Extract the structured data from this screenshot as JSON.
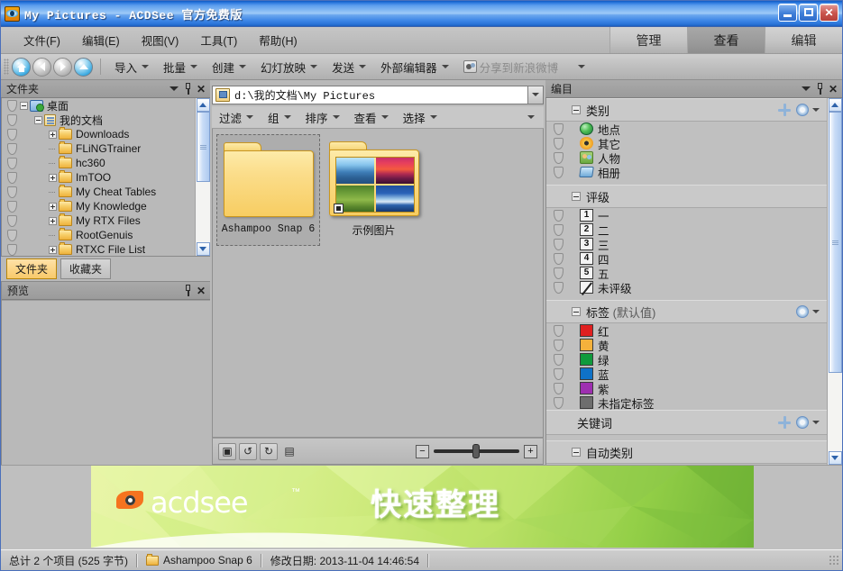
{
  "window": {
    "title": "My Pictures - ACDSee 官方免费版",
    "app_icon": "acdsee-eye-icon",
    "minimize_label": "_",
    "maximize_label": "□",
    "close_label": "✕"
  },
  "menubar": {
    "items": [
      {
        "label": "文件(F)",
        "accel": "F"
      },
      {
        "label": "编辑(E)",
        "accel": "E"
      },
      {
        "label": "视图(V)",
        "accel": "V"
      },
      {
        "label": "工具(T)",
        "accel": "T"
      },
      {
        "label": "帮助(H)",
        "accel": "H"
      }
    ],
    "mode_tabs": [
      {
        "label": "管理",
        "active": false
      },
      {
        "label": "查看",
        "active": true
      },
      {
        "label": "编辑",
        "active": false
      }
    ]
  },
  "toolbar": {
    "nav": [
      {
        "name": "home-button",
        "glyph": "home"
      },
      {
        "name": "back-button",
        "glyph": "left"
      },
      {
        "name": "forward-button",
        "glyph": "right"
      },
      {
        "name": "up-button",
        "glyph": "up"
      }
    ],
    "items": [
      {
        "label": "导入"
      },
      {
        "label": "批量"
      },
      {
        "label": "创建"
      },
      {
        "label": "幻灯放映"
      },
      {
        "label": "发送"
      },
      {
        "label": "外部编辑器"
      }
    ],
    "share": {
      "label": "分享到新浪微博",
      "icon": "weibo-icon"
    }
  },
  "folders_panel": {
    "title": "文件夹",
    "tree": [
      {
        "label": "桌面",
        "depth": 0,
        "expander": "minus",
        "icon": "desktop-icon"
      },
      {
        "label": "我的文档",
        "depth": 1,
        "expander": "minus",
        "icon": "my-documents-icon"
      },
      {
        "label": "Downloads",
        "depth": 2,
        "expander": "plus",
        "icon": "folder-icon"
      },
      {
        "label": "FLiNGTrainer",
        "depth": 2,
        "expander": "none",
        "icon": "folder-icon"
      },
      {
        "label": "hc360",
        "depth": 2,
        "expander": "none",
        "icon": "folder-icon"
      },
      {
        "label": "ImTOO",
        "depth": 2,
        "expander": "plus",
        "icon": "folder-icon"
      },
      {
        "label": "My Cheat Tables",
        "depth": 2,
        "expander": "none",
        "icon": "folder-icon"
      },
      {
        "label": "My Knowledge",
        "depth": 2,
        "expander": "plus",
        "icon": "folder-icon"
      },
      {
        "label": "My RTX Files",
        "depth": 2,
        "expander": "plus",
        "icon": "folder-icon"
      },
      {
        "label": "RootGenuis",
        "depth": 2,
        "expander": "none",
        "icon": "folder-icon"
      },
      {
        "label": "RTXC File List",
        "depth": 2,
        "expander": "plus",
        "icon": "folder-icon"
      }
    ],
    "tabs": [
      {
        "label": "文件夹",
        "selected": true
      },
      {
        "label": "收藏夹",
        "selected": false
      }
    ]
  },
  "preview_panel": {
    "title": "预览"
  },
  "address_bar": {
    "path": "d:\\我的文档\\My Pictures",
    "icon": "my-pictures-folder-icon"
  },
  "filter_bar": {
    "items": [
      {
        "label": "过滤"
      },
      {
        "label": "组"
      },
      {
        "label": "排序"
      },
      {
        "label": "查看"
      },
      {
        "label": "选择"
      }
    ]
  },
  "content": {
    "items": [
      {
        "label": "Ashampoo Snap 6",
        "type": "folder-empty",
        "selected": true
      },
      {
        "label": "示例图片",
        "type": "folder-with-thumbnails",
        "selected": false
      }
    ]
  },
  "content_bottom": {
    "buttons": [
      {
        "name": "image-well-button",
        "glyph": "▣"
      },
      {
        "name": "rotate-left-button",
        "glyph": "↺"
      },
      {
        "name": "rotate-right-button",
        "glyph": "↻"
      },
      {
        "name": "filmstrip-button",
        "glyph": "▤"
      }
    ],
    "zoom": {
      "minus": "−",
      "plus": "+",
      "value": 45
    }
  },
  "catalog_panel": {
    "title": "编目",
    "groups": [
      {
        "title": "类别",
        "sub": "",
        "has_plus": true,
        "has_gear": true,
        "items": [
          {
            "label": "地点",
            "icon": "globe-icon"
          },
          {
            "label": "其它",
            "icon": "flower-icon"
          },
          {
            "label": "人物",
            "icon": "people-icon"
          },
          {
            "label": "相册",
            "icon": "album-icon"
          }
        ]
      },
      {
        "title": "评级",
        "sub": "",
        "has_plus": false,
        "has_gear": false,
        "items": [
          {
            "label": "一",
            "icon": "rating-1-icon",
            "num": "1"
          },
          {
            "label": "二",
            "icon": "rating-2-icon",
            "num": "2"
          },
          {
            "label": "三",
            "icon": "rating-3-icon",
            "num": "3"
          },
          {
            "label": "四",
            "icon": "rating-4-icon",
            "num": "4"
          },
          {
            "label": "五",
            "icon": "rating-5-icon",
            "num": "5"
          },
          {
            "label": "未评级",
            "icon": "unrated-icon",
            "num": ""
          }
        ]
      },
      {
        "title": "标签",
        "sub": "(默认值)",
        "has_plus": false,
        "has_gear": true,
        "items": [
          {
            "label": "红",
            "icon": "swatch-red-icon",
            "color": "#e02020"
          },
          {
            "label": "黄",
            "icon": "swatch-yellow-icon",
            "color": "#f5b13c"
          },
          {
            "label": "绿",
            "icon": "swatch-green-icon",
            "color": "#0f9a3c"
          },
          {
            "label": "蓝",
            "icon": "swatch-blue-icon",
            "color": "#0f72c8"
          },
          {
            "label": "紫",
            "icon": "swatch-purple-icon",
            "color": "#9e2fb0"
          },
          {
            "label": "未指定标签",
            "icon": "swatch-none-icon",
            "color": "#6e6e6e"
          }
        ]
      }
    ],
    "keywords": {
      "title": "关键词",
      "has_plus": true,
      "has_gear": true
    },
    "auto_categories": {
      "title": "自动类别"
    }
  },
  "banner": {
    "brand": "acdsee",
    "tm": "™",
    "headline": "快速整理"
  },
  "statusbar": {
    "total": "总计 2 个项目 (525 字节)",
    "selected_name": "Ashampoo Snap 6",
    "modified": "修改日期: 2013-11-04 14:46:54"
  },
  "colors": {
    "title_blue": "#3f84e0",
    "chrome_gray": "#b9b9b9",
    "accent_orange": "#f5731f",
    "tab_selected": "#f8c96a"
  }
}
